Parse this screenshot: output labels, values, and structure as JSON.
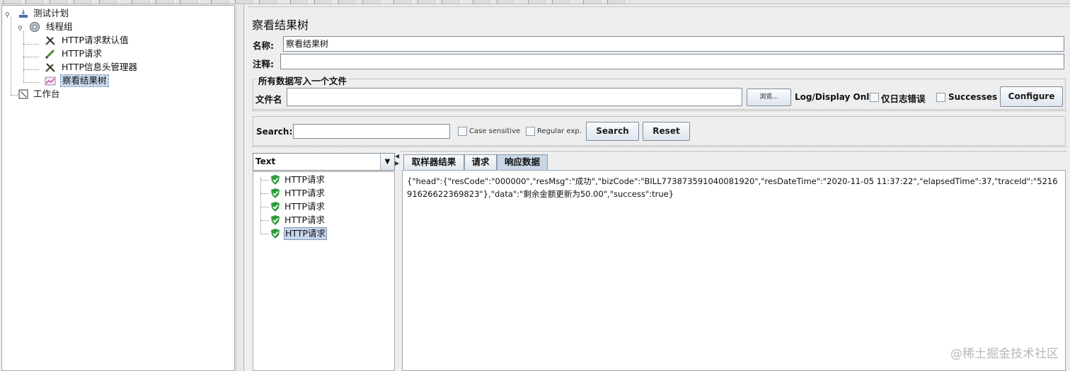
{
  "tree": {
    "items": [
      {
        "label": "测试计划",
        "icon": "test-plan-icon"
      },
      {
        "label": "线程组",
        "icon": "thread-group-gear-icon"
      },
      {
        "label": "HTTP请求默认值",
        "icon": "config-wrench-icon"
      },
      {
        "label": "HTTP请求",
        "icon": "sampler-pen-icon"
      },
      {
        "label": "HTTP信息头管理器",
        "icon": "config-wrench-icon"
      },
      {
        "label": "察看结果树",
        "icon": "listener-graph-icon"
      },
      {
        "label": "工作台",
        "icon": "workbench-icon"
      }
    ]
  },
  "panel": {
    "title": "察看结果树",
    "name_label": "名称:",
    "name_value": "察看结果树",
    "comment_label": "注释:",
    "comment_value": "",
    "file_section_title": "所有数据写入一个文件",
    "filename_label": "文件名",
    "filename_value": "",
    "browse_label": "浏览...",
    "log_display_label": "Log/Display Only:",
    "errors_only_label": "仅日志错误",
    "successes_label": "Successes",
    "configure_label": "Configure"
  },
  "search": {
    "label": "Search:",
    "value": "",
    "case_sensitive_label": "Case sensitive",
    "regex_label": "Regular exp.",
    "search_button": "Search",
    "reset_button": "Reset"
  },
  "results": {
    "renderer_select": "Text",
    "samples": [
      "HTTP请求",
      "HTTP请求",
      "HTTP请求",
      "HTTP请求",
      "HTTP请求"
    ],
    "tabs": [
      "取样器结果",
      "请求",
      "响应数据"
    ],
    "active_tab": 2,
    "response_text": "{\"head\":{\"resCode\":\"000000\",\"resMsg\":\"成功\",\"bizCode\":\"BILL773873591040081920\",\"resDateTime\":\"2020-11-05 11:37:22\",\"elapsedTime\":37,\"traceId\":\"521691626622369823\"},\"data\":\"剩余金额更新为50.00\",\"success\":true}"
  },
  "watermark": "@稀土掘金技术社区",
  "colors": {
    "selection_bg": "#c7d7ec",
    "success_shield": "#2e9b3a",
    "button_border": "#7d8b9a"
  }
}
